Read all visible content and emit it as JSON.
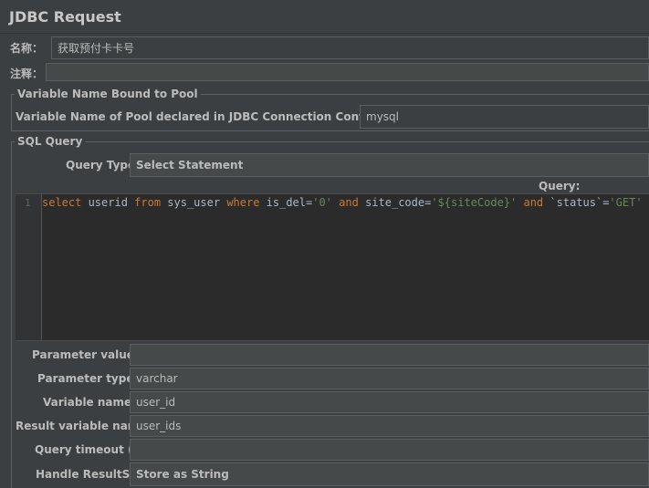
{
  "window": {
    "title": "JDBC Request"
  },
  "name": {
    "label": "名称：",
    "value": "获取预付卡卡号"
  },
  "comment": {
    "label": "注释：",
    "value": ""
  },
  "pool": {
    "legend": "Variable Name Bound to Pool",
    "label": "Variable Name of Pool declared in JDBC Connection Configuration:",
    "value": "mysql"
  },
  "sql": {
    "legend": "SQL Query",
    "query_type_label": "Query Type:",
    "query_type_value": "Select Statement",
    "query_label": "Query:",
    "line_number": "1",
    "code_tokens": [
      {
        "t": "select",
        "k": "kw"
      },
      {
        "t": " userid ",
        "k": "plain"
      },
      {
        "t": "from",
        "k": "kw"
      },
      {
        "t": " sys_user ",
        "k": "plain"
      },
      {
        "t": "where",
        "k": "kw"
      },
      {
        "t": " is_del=",
        "k": "plain"
      },
      {
        "t": "'0'",
        "k": "str"
      },
      {
        "t": " ",
        "k": "plain"
      },
      {
        "t": "and",
        "k": "kw"
      },
      {
        "t": " site_code=",
        "k": "plain"
      },
      {
        "t": "'${siteCode}'",
        "k": "str"
      },
      {
        "t": " ",
        "k": "plain"
      },
      {
        "t": "and",
        "k": "kw"
      },
      {
        "t": " `status`=",
        "k": "plain"
      },
      {
        "t": "'GET'",
        "k": "str"
      }
    ]
  },
  "params": {
    "parameter_values_label": "Parameter values:",
    "parameter_values": "",
    "parameter_types_label": "Parameter types:",
    "parameter_types": "varchar",
    "variable_names_label": "Variable names:",
    "variable_names": "user_id",
    "result_variable_label": "Result variable name:",
    "result_variable": "user_ids",
    "query_timeout_label": "Query timeout (s):",
    "query_timeout": "",
    "handle_resultset_label": "Handle ResultSet:",
    "handle_resultset": "Store as String"
  }
}
